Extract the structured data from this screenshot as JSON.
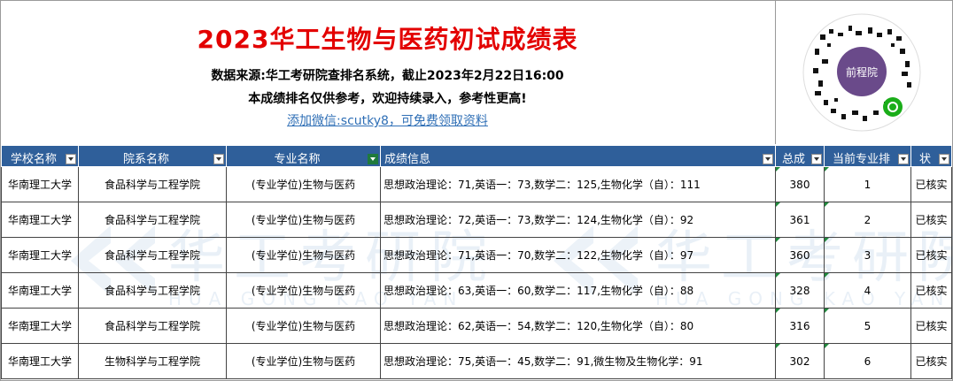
{
  "header": {
    "title": "2023华工生物与医药初试成绩表",
    "source_line": "数据来源:华工考研院查排名系统，截止2023年2月22日16:00",
    "notice_line": "本成绩排名仅供参考，欢迎持续录入，参考性更高!",
    "wechat_link": "添加微信:scutky8，可免费领取资料"
  },
  "qr": {
    "center_label": "前程院"
  },
  "watermark": {
    "text": "华工考研院",
    "sub_left": "HUA GONG KAO YAN",
    "sub_right": "HUA GONG KAO YAN YUAN"
  },
  "columns": [
    "学校名称",
    "院系名称",
    "专业名称",
    "成绩信息",
    "总成绩",
    "当前专业排名",
    "状态"
  ],
  "rows": [
    {
      "school": "华南理工大学",
      "dept": "食品科学与工程学院",
      "major": "(专业学位)生物与医药",
      "info": "思想政治理论：71,英语一：73,数学二：125,生物化学（自）：111",
      "total": "380",
      "rank": "1",
      "status": "已核实"
    },
    {
      "school": "华南理工大学",
      "dept": "食品科学与工程学院",
      "major": "(专业学位)生物与医药",
      "info": "思想政治理论：72,英语一：73,数学二：124,生物化学（自）：92",
      "total": "361",
      "rank": "2",
      "status": "已核实"
    },
    {
      "school": "华南理工大学",
      "dept": "食品科学与工程学院",
      "major": "(专业学位)生物与医药",
      "info": "思想政治理论：71,英语一：70,数学二：122,生物化学（自）：97",
      "total": "360",
      "rank": "3",
      "status": "已核实"
    },
    {
      "school": "华南理工大学",
      "dept": "食品科学与工程学院",
      "major": "(专业学位)生物与医药",
      "info": "思想政治理论：63,英语一：60,数学二：117,生物化学（自）：88",
      "total": "328",
      "rank": "4",
      "status": "已核实"
    },
    {
      "school": "华南理工大学",
      "dept": "食品科学与工程学院",
      "major": "(专业学位)生物与医药",
      "info": "思想政治理论：62,英语一：54,数学二：120,生物化学（自）：80",
      "total": "316",
      "rank": "5",
      "status": "已核实"
    },
    {
      "school": "华南理工大学",
      "dept": "生物科学与工程学院",
      "major": "(专业学位)生物与医药",
      "info": "思想政治理论：75,英语一：45,数学二：91,微生物及生物化学：91",
      "total": "302",
      "rank": "6",
      "status": "已核实"
    }
  ],
  "colors": {
    "title": "#e30000",
    "header_bg": "#2f5f9a",
    "link": "#2f6fb6"
  }
}
